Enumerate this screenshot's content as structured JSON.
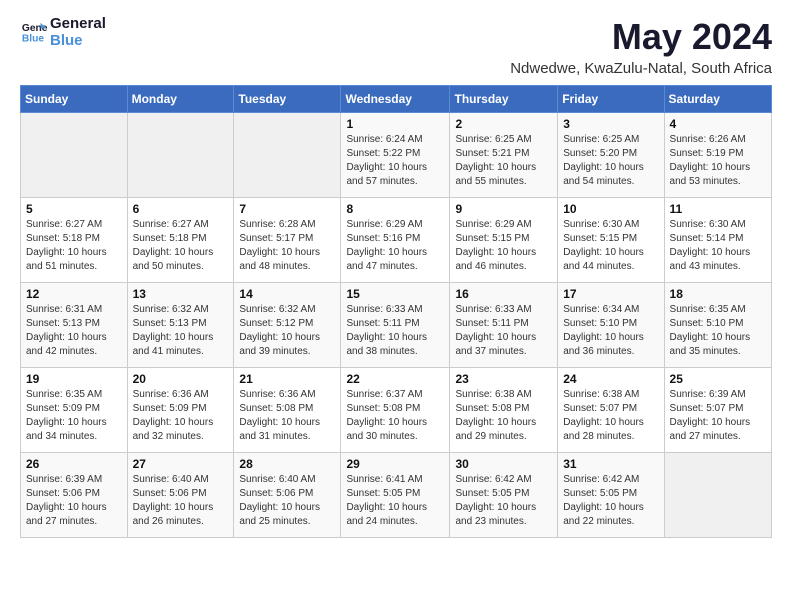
{
  "header": {
    "logo_line1": "General",
    "logo_line2": "Blue",
    "month_year": "May 2024",
    "location": "Ndwedwe, KwaZulu-Natal, South Africa"
  },
  "weekdays": [
    "Sunday",
    "Monday",
    "Tuesday",
    "Wednesday",
    "Thursday",
    "Friday",
    "Saturday"
  ],
  "weeks": [
    [
      {
        "day": "",
        "sunrise": "",
        "sunset": "",
        "daylight": "",
        "empty": true
      },
      {
        "day": "",
        "sunrise": "",
        "sunset": "",
        "daylight": "",
        "empty": true
      },
      {
        "day": "",
        "sunrise": "",
        "sunset": "",
        "daylight": "",
        "empty": true
      },
      {
        "day": "1",
        "sunrise": "Sunrise: 6:24 AM",
        "sunset": "Sunset: 5:22 PM",
        "daylight": "Daylight: 10 hours and 57 minutes."
      },
      {
        "day": "2",
        "sunrise": "Sunrise: 6:25 AM",
        "sunset": "Sunset: 5:21 PM",
        "daylight": "Daylight: 10 hours and 55 minutes."
      },
      {
        "day": "3",
        "sunrise": "Sunrise: 6:25 AM",
        "sunset": "Sunset: 5:20 PM",
        "daylight": "Daylight: 10 hours and 54 minutes."
      },
      {
        "day": "4",
        "sunrise": "Sunrise: 6:26 AM",
        "sunset": "Sunset: 5:19 PM",
        "daylight": "Daylight: 10 hours and 53 minutes."
      }
    ],
    [
      {
        "day": "5",
        "sunrise": "Sunrise: 6:27 AM",
        "sunset": "Sunset: 5:18 PM",
        "daylight": "Daylight: 10 hours and 51 minutes."
      },
      {
        "day": "6",
        "sunrise": "Sunrise: 6:27 AM",
        "sunset": "Sunset: 5:18 PM",
        "daylight": "Daylight: 10 hours and 50 minutes."
      },
      {
        "day": "7",
        "sunrise": "Sunrise: 6:28 AM",
        "sunset": "Sunset: 5:17 PM",
        "daylight": "Daylight: 10 hours and 48 minutes."
      },
      {
        "day": "8",
        "sunrise": "Sunrise: 6:29 AM",
        "sunset": "Sunset: 5:16 PM",
        "daylight": "Daylight: 10 hours and 47 minutes."
      },
      {
        "day": "9",
        "sunrise": "Sunrise: 6:29 AM",
        "sunset": "Sunset: 5:15 PM",
        "daylight": "Daylight: 10 hours and 46 minutes."
      },
      {
        "day": "10",
        "sunrise": "Sunrise: 6:30 AM",
        "sunset": "Sunset: 5:15 PM",
        "daylight": "Daylight: 10 hours and 44 minutes."
      },
      {
        "day": "11",
        "sunrise": "Sunrise: 6:30 AM",
        "sunset": "Sunset: 5:14 PM",
        "daylight": "Daylight: 10 hours and 43 minutes."
      }
    ],
    [
      {
        "day": "12",
        "sunrise": "Sunrise: 6:31 AM",
        "sunset": "Sunset: 5:13 PM",
        "daylight": "Daylight: 10 hours and 42 minutes."
      },
      {
        "day": "13",
        "sunrise": "Sunrise: 6:32 AM",
        "sunset": "Sunset: 5:13 PM",
        "daylight": "Daylight: 10 hours and 41 minutes."
      },
      {
        "day": "14",
        "sunrise": "Sunrise: 6:32 AM",
        "sunset": "Sunset: 5:12 PM",
        "daylight": "Daylight: 10 hours and 39 minutes."
      },
      {
        "day": "15",
        "sunrise": "Sunrise: 6:33 AM",
        "sunset": "Sunset: 5:11 PM",
        "daylight": "Daylight: 10 hours and 38 minutes."
      },
      {
        "day": "16",
        "sunrise": "Sunrise: 6:33 AM",
        "sunset": "Sunset: 5:11 PM",
        "daylight": "Daylight: 10 hours and 37 minutes."
      },
      {
        "day": "17",
        "sunrise": "Sunrise: 6:34 AM",
        "sunset": "Sunset: 5:10 PM",
        "daylight": "Daylight: 10 hours and 36 minutes."
      },
      {
        "day": "18",
        "sunrise": "Sunrise: 6:35 AM",
        "sunset": "Sunset: 5:10 PM",
        "daylight": "Daylight: 10 hours and 35 minutes."
      }
    ],
    [
      {
        "day": "19",
        "sunrise": "Sunrise: 6:35 AM",
        "sunset": "Sunset: 5:09 PM",
        "daylight": "Daylight: 10 hours and 34 minutes."
      },
      {
        "day": "20",
        "sunrise": "Sunrise: 6:36 AM",
        "sunset": "Sunset: 5:09 PM",
        "daylight": "Daylight: 10 hours and 32 minutes."
      },
      {
        "day": "21",
        "sunrise": "Sunrise: 6:36 AM",
        "sunset": "Sunset: 5:08 PM",
        "daylight": "Daylight: 10 hours and 31 minutes."
      },
      {
        "day": "22",
        "sunrise": "Sunrise: 6:37 AM",
        "sunset": "Sunset: 5:08 PM",
        "daylight": "Daylight: 10 hours and 30 minutes."
      },
      {
        "day": "23",
        "sunrise": "Sunrise: 6:38 AM",
        "sunset": "Sunset: 5:08 PM",
        "daylight": "Daylight: 10 hours and 29 minutes."
      },
      {
        "day": "24",
        "sunrise": "Sunrise: 6:38 AM",
        "sunset": "Sunset: 5:07 PM",
        "daylight": "Daylight: 10 hours and 28 minutes."
      },
      {
        "day": "25",
        "sunrise": "Sunrise: 6:39 AM",
        "sunset": "Sunset: 5:07 PM",
        "daylight": "Daylight: 10 hours and 27 minutes."
      }
    ],
    [
      {
        "day": "26",
        "sunrise": "Sunrise: 6:39 AM",
        "sunset": "Sunset: 5:06 PM",
        "daylight": "Daylight: 10 hours and 27 minutes."
      },
      {
        "day": "27",
        "sunrise": "Sunrise: 6:40 AM",
        "sunset": "Sunset: 5:06 PM",
        "daylight": "Daylight: 10 hours and 26 minutes."
      },
      {
        "day": "28",
        "sunrise": "Sunrise: 6:40 AM",
        "sunset": "Sunset: 5:06 PM",
        "daylight": "Daylight: 10 hours and 25 minutes."
      },
      {
        "day": "29",
        "sunrise": "Sunrise: 6:41 AM",
        "sunset": "Sunset: 5:05 PM",
        "daylight": "Daylight: 10 hours and 24 minutes."
      },
      {
        "day": "30",
        "sunrise": "Sunrise: 6:42 AM",
        "sunset": "Sunset: 5:05 PM",
        "daylight": "Daylight: 10 hours and 23 minutes."
      },
      {
        "day": "31",
        "sunrise": "Sunrise: 6:42 AM",
        "sunset": "Sunset: 5:05 PM",
        "daylight": "Daylight: 10 hours and 22 minutes."
      },
      {
        "day": "",
        "sunrise": "",
        "sunset": "",
        "daylight": "",
        "empty": true
      }
    ]
  ]
}
